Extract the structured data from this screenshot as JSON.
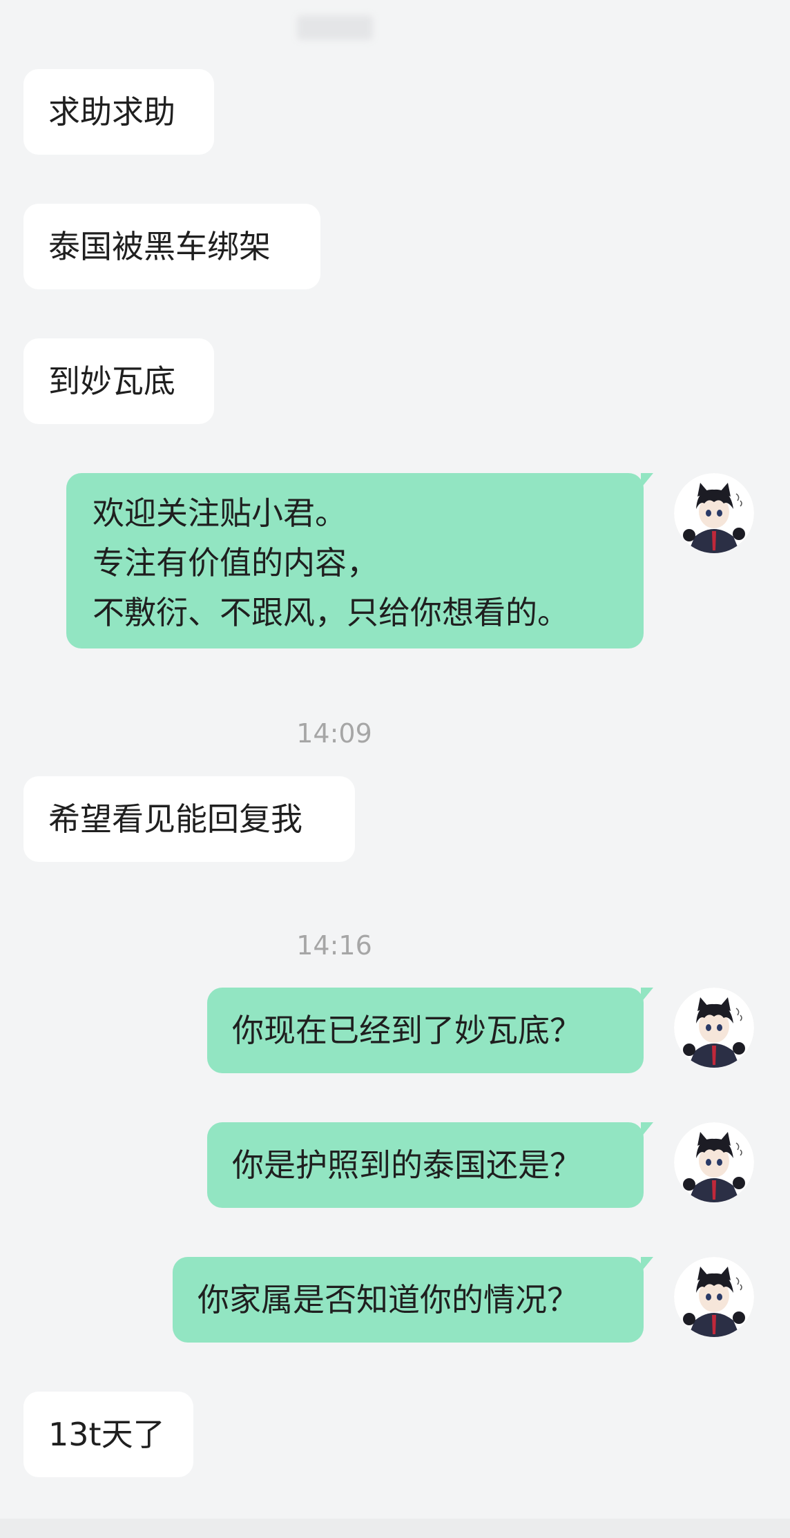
{
  "chat": {
    "messages": [
      {
        "side": "in",
        "text": "求助求助"
      },
      {
        "side": "in",
        "text": "泰国被黑车绑架"
      },
      {
        "side": "in",
        "text": "到妙瓦底"
      },
      {
        "side": "out",
        "lines": [
          "欢迎关注贴小君。",
          "专注有价值的内容，",
          "不敷衍、不跟风，只给你想看的。"
        ]
      },
      {
        "side": "in",
        "text": "希望看见能回复我"
      },
      {
        "side": "out",
        "text": "你现在已经到了妙瓦底？"
      },
      {
        "side": "out",
        "text": "你是护照到的泰国还是？"
      },
      {
        "side": "out",
        "text": "你家属是否知道你的情况？"
      },
      {
        "side": "in",
        "text": "13t天了"
      }
    ],
    "timestamps": [
      "14:09",
      "14:16"
    ]
  },
  "avatar": {
    "icon": "cat-boy-avatar",
    "colors": {
      "hair": "#1c1c24",
      "skin": "#f6e6da",
      "suit": "#2b2f45",
      "tie": "#c0283a"
    }
  },
  "colors": {
    "background": "#f3f4f5",
    "incoming_bubble": "#ffffff",
    "outgoing_bubble": "#92e5c2",
    "timestamp": "#a6a6a6"
  }
}
